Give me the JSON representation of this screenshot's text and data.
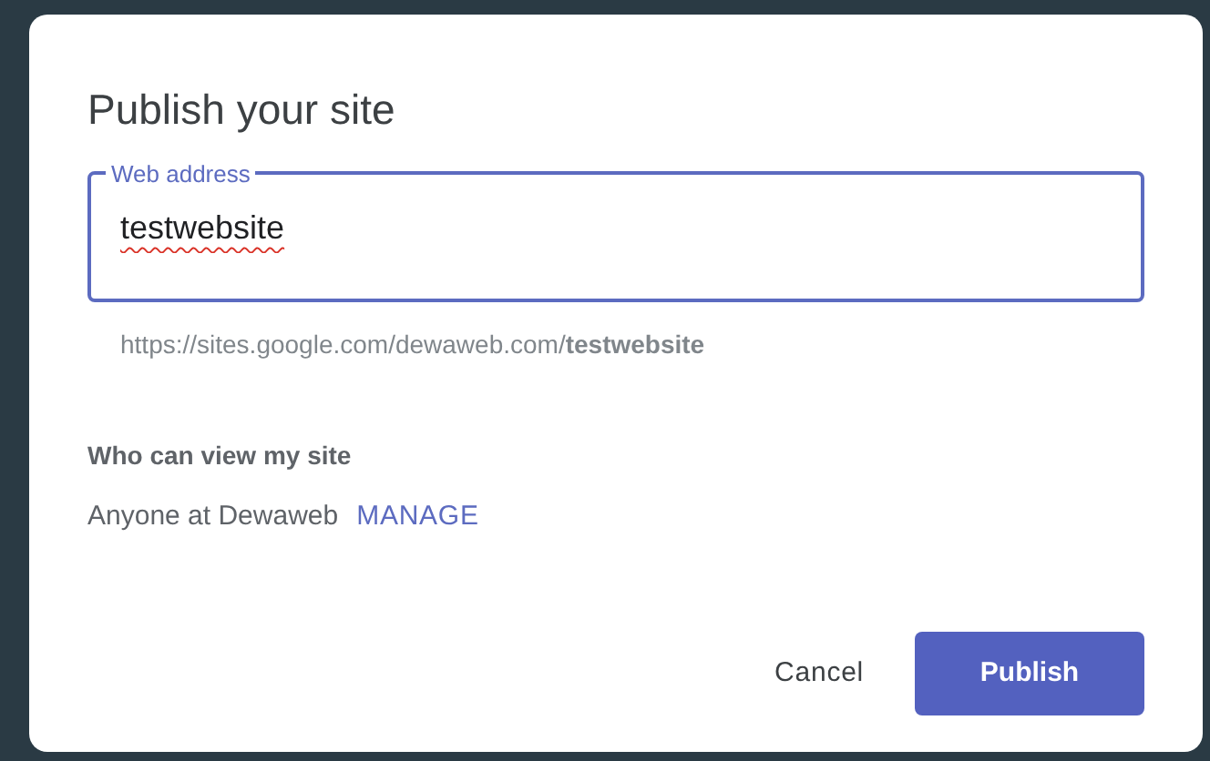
{
  "dialog": {
    "title": "Publish your site",
    "web_address": {
      "label": "Web address",
      "value": "testwebsite",
      "focused": true
    },
    "url_preview": "https://sites.google.com/dewaweb.com/**testwebsite**",
    "visibility": {
      "heading": "Who can view my site",
      "value": "Anyone at Dewaweb",
      "link": "MANAGE"
    },
    "buttons": [
      {
        "label": "Cancel",
        "kind": "text"
      },
      {
        "label": "Publish",
        "kind": "primary"
      }
    ]
  }
}
